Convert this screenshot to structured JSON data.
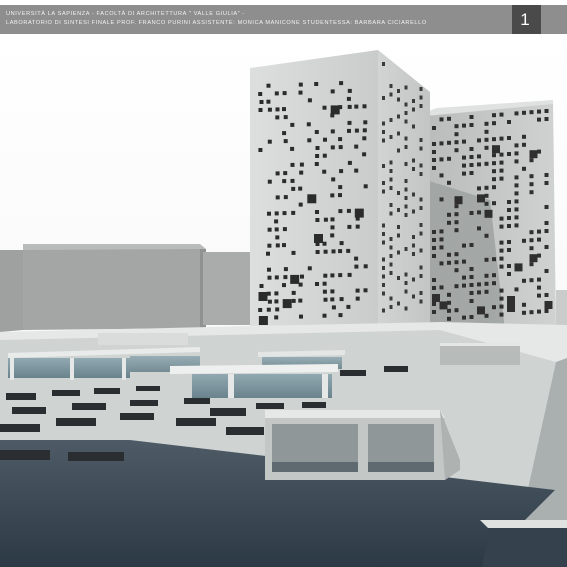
{
  "header": {
    "line1": "UNIVERSITÀ LA SAPIENZA - FACOLTÀ DI ARCHITETTURA \" VALLE GIULIA\" -",
    "line2": "LABORATORIO DI SINTESI FINALE  PROF. FRANCO PURINI  ASSISTENTE: MONICA MANICONE  STUDENTESSA: BARBARA CICIARELLO",
    "page_number": "1 1"
  },
  "colors": {
    "header_bar": "#8e8e8e",
    "page_number_box": "#4a4a4a"
  }
}
